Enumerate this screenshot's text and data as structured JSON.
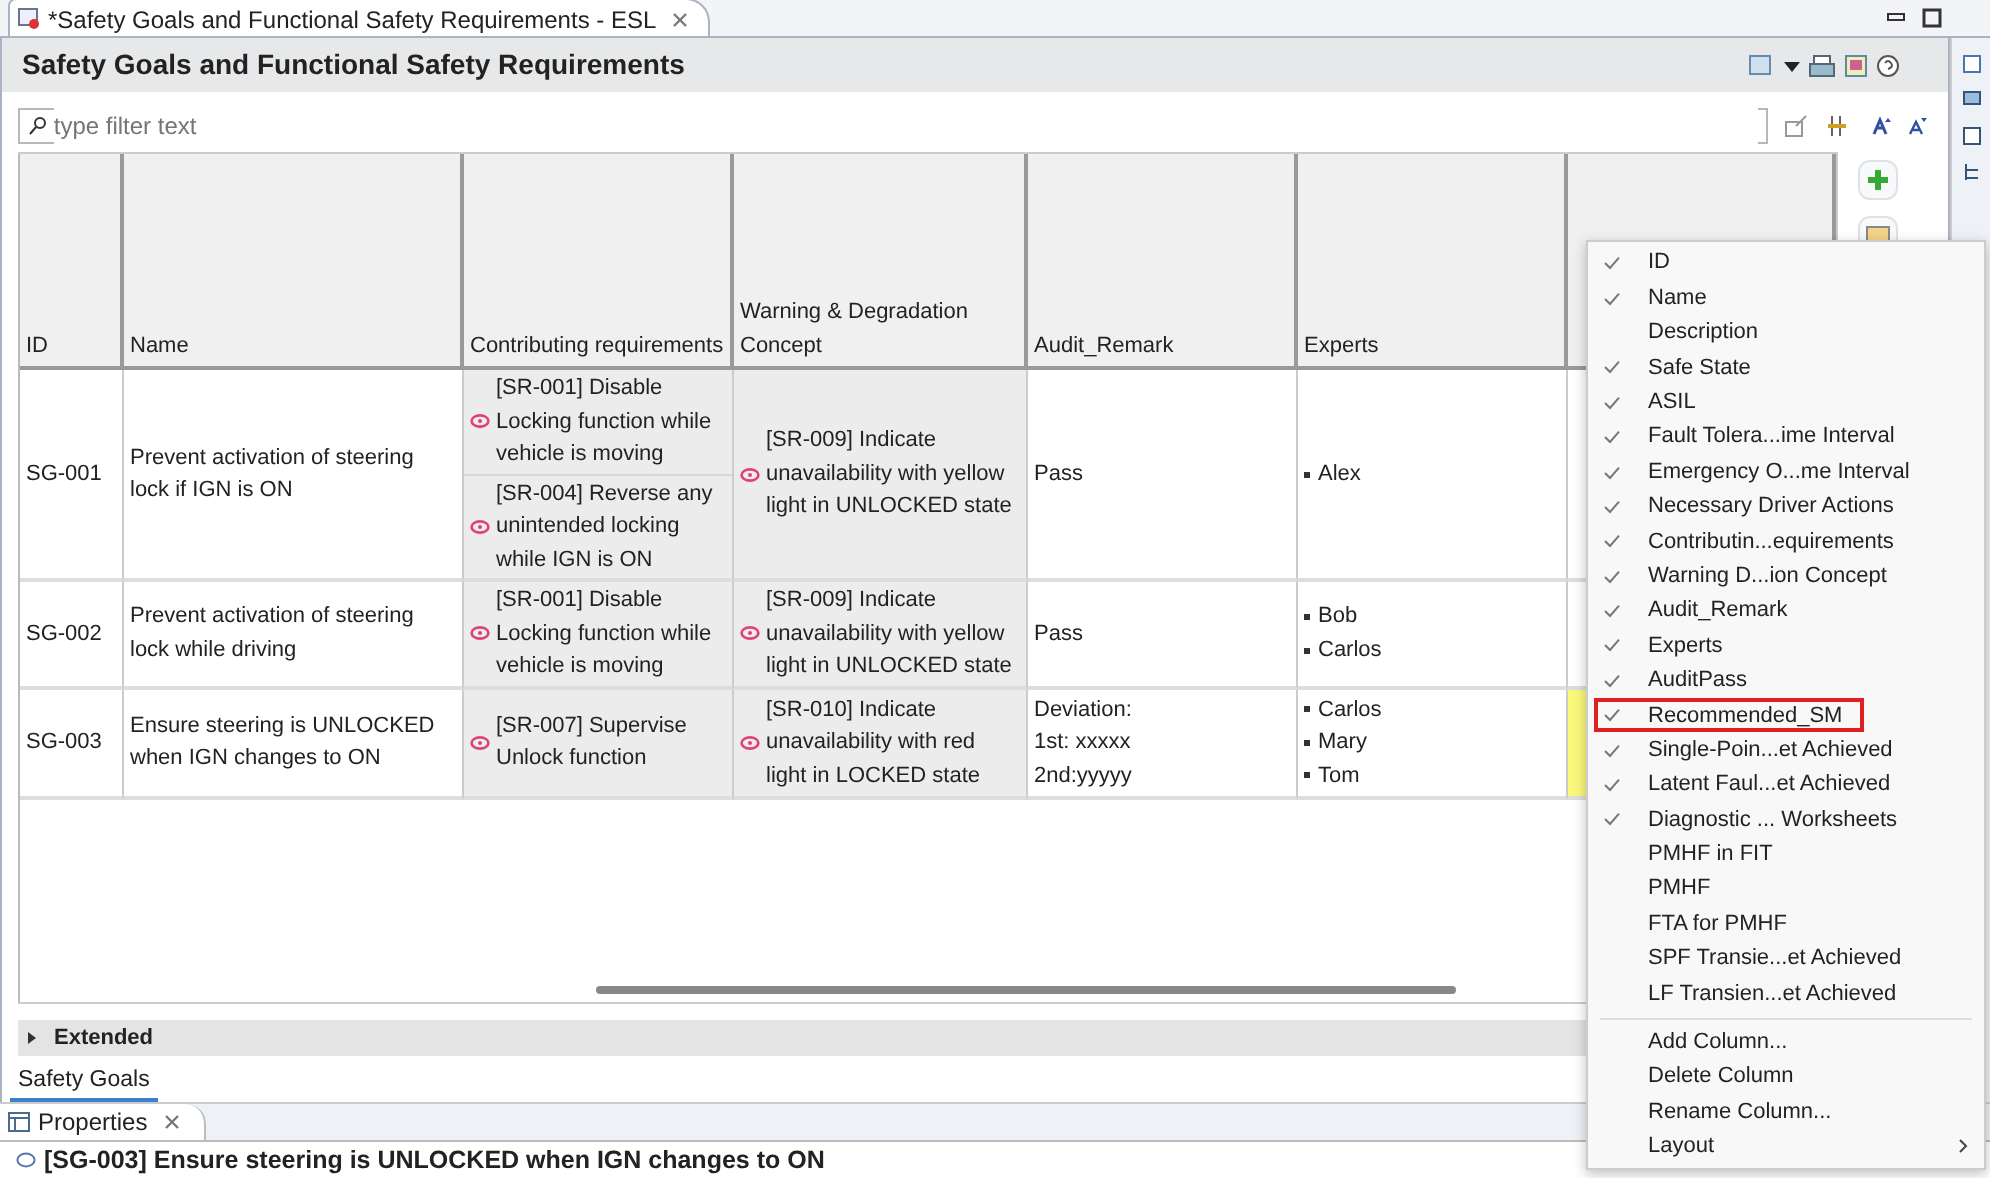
{
  "editor_tab": {
    "title": "*Safety Goals and Functional Safety Requirements - ESL"
  },
  "page_title": "Safety Goals and Functional Safety Requirements",
  "filter": {
    "placeholder": "type filter text"
  },
  "table": {
    "columns": [
      "ID",
      "Name",
      "Contributing requirements",
      "Warning & Degradation Concept",
      "Audit_Remark",
      "Experts",
      ""
    ],
    "rows": [
      {
        "id": "SG-001",
        "name": "Prevent activation of steering lock if IGN is ON",
        "requirements": [
          "[SR-001] Disable Locking function while vehicle is moving",
          "[SR-004] Reverse any unintended locking while IGN is ON"
        ],
        "warning": [
          "[SR-009] Indicate unavailability with yellow light in UNLOCKED state"
        ],
        "audit_remark": "Pass",
        "experts": [
          "Alex"
        ],
        "highlighted": false
      },
      {
        "id": "SG-002",
        "name": "Prevent activation of steering lock while driving",
        "requirements": [
          "[SR-001] Disable Locking function while vehicle is moving"
        ],
        "warning": [
          "[SR-009] Indicate unavailability with yellow light in UNLOCKED state"
        ],
        "audit_remark": "Pass",
        "experts": [
          "Bob",
          "Carlos"
        ],
        "highlighted": false
      },
      {
        "id": "SG-003",
        "name": "Ensure steering is UNLOCKED when IGN changes to ON",
        "requirements": [
          "[SR-007] Supervise Unlock function"
        ],
        "warning": [
          "[SR-010] Indicate unavailability with red light in LOCKED state"
        ],
        "audit_remark": "Deviation:\n1st: xxxxx\n2nd:yyyyy",
        "experts": [
          "Carlos",
          "Mary",
          "Tom"
        ],
        "highlighted": true
      }
    ]
  },
  "sections": [
    {
      "label": "Extended",
      "expanded": false
    }
  ],
  "page_tabs": [
    {
      "label": "Safety Goals",
      "selected": true
    }
  ],
  "properties_view": {
    "title": "Properties",
    "selection": "[SG-003] Ensure steering is UNLOCKED when IGN changes to ON"
  },
  "column_menu": {
    "items": [
      {
        "label": "ID",
        "checked": true,
        "highlighted": false
      },
      {
        "label": "Name",
        "checked": true,
        "highlighted": false
      },
      {
        "label": "Description",
        "checked": false,
        "highlighted": false
      },
      {
        "label": "Safe State",
        "checked": true,
        "highlighted": false
      },
      {
        "label": "ASIL",
        "checked": true,
        "highlighted": false
      },
      {
        "label": "Fault Tolera...ime Interval",
        "checked": true,
        "highlighted": false
      },
      {
        "label": "Emergency O...me Interval",
        "checked": true,
        "highlighted": false
      },
      {
        "label": "Necessary Driver Actions",
        "checked": true,
        "highlighted": false
      },
      {
        "label": "Contributin...equirements",
        "checked": true,
        "highlighted": false
      },
      {
        "label": "Warning  D...ion Concept",
        "checked": true,
        "highlighted": false
      },
      {
        "label": "Audit_Remark",
        "checked": true,
        "highlighted": false
      },
      {
        "label": "Experts",
        "checked": true,
        "highlighted": false
      },
      {
        "label": "AuditPass",
        "checked": true,
        "highlighted": false
      },
      {
        "label": "Recommended_SM",
        "checked": true,
        "highlighted": true
      },
      {
        "label": "Single-Poin...et Achieved",
        "checked": true,
        "highlighted": false
      },
      {
        "label": "Latent Faul...et Achieved",
        "checked": true,
        "highlighted": false
      },
      {
        "label": "Diagnostic ... Worksheets",
        "checked": true,
        "highlighted": false
      },
      {
        "label": "PMHF in FIT",
        "checked": false,
        "highlighted": false
      },
      {
        "label": "PMHF",
        "checked": false,
        "highlighted": false
      },
      {
        "label": "FTA for PMHF",
        "checked": false,
        "highlighted": false
      },
      {
        "label": "SPF Transie...et Achieved",
        "checked": false,
        "highlighted": false
      },
      {
        "label": "LF Transien...et Achieved",
        "checked": false,
        "highlighted": false
      }
    ],
    "actions": [
      {
        "label": "Add Column...",
        "submenu": false
      },
      {
        "label": "Delete Column",
        "submenu": false
      },
      {
        "label": "Rename Column...",
        "submenu": false
      },
      {
        "label": "Layout",
        "submenu": true
      }
    ]
  }
}
